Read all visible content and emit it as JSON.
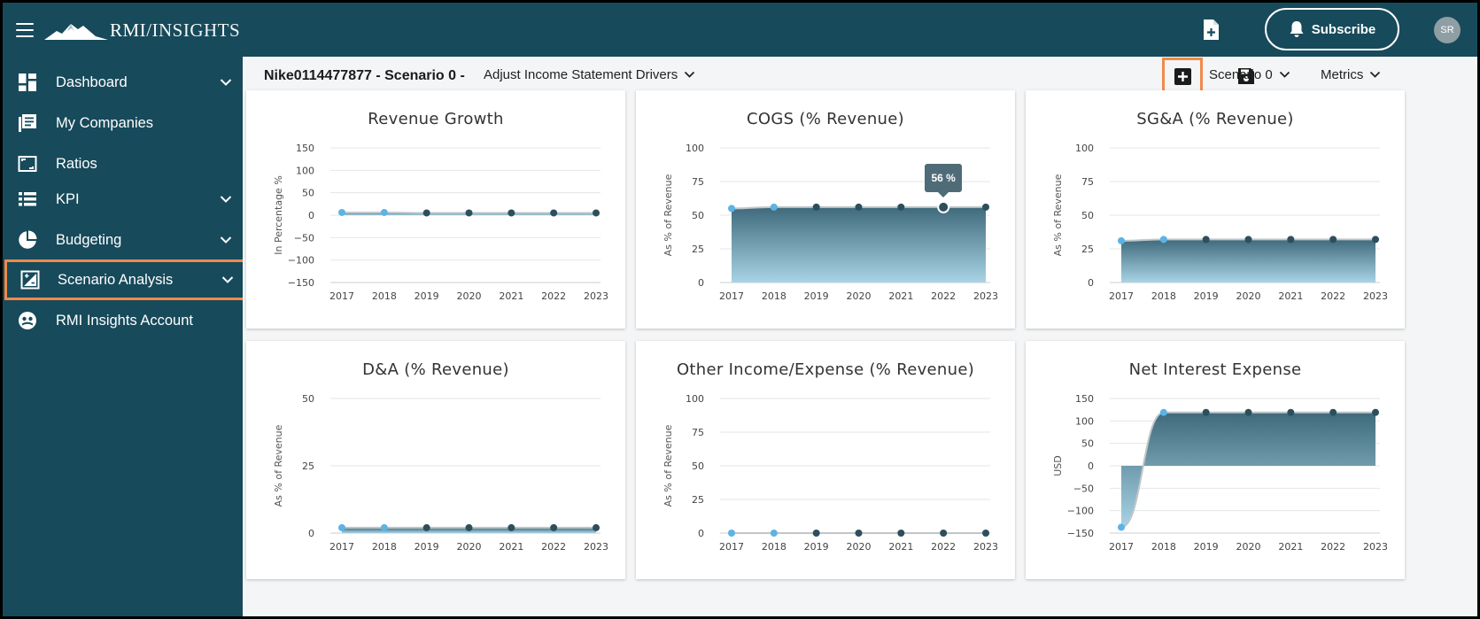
{
  "app": {
    "logo_text_bold": "RMI",
    "logo_text_light": "/INSIGHTS",
    "subscribe_label": "Subscribe",
    "user_initials": "SR"
  },
  "sidebar": {
    "items": [
      {
        "label": "Dashboard",
        "icon": "dashboard-icon",
        "has_chevron": true
      },
      {
        "label": "My Companies",
        "icon": "companies-icon",
        "has_chevron": false
      },
      {
        "label": "Ratios",
        "icon": "ratios-icon",
        "has_chevron": false
      },
      {
        "label": "KPI",
        "icon": "kpi-icon",
        "has_chevron": true
      },
      {
        "label": "Budgeting",
        "icon": "budgeting-icon",
        "has_chevron": true
      },
      {
        "label": "Scenario Analysis",
        "icon": "scenario-icon",
        "has_chevron": true,
        "active": true
      },
      {
        "label": "RMI Insights Account",
        "icon": "account-icon",
        "has_chevron": false
      }
    ]
  },
  "subheader": {
    "title": "Nike0114477877 - Scenario 0 -",
    "driver_select": "Adjust Income Statement Drivers",
    "scenario_select": "Scenario 0",
    "metrics_select": "Metrics"
  },
  "colors": {
    "brand": "#174a5b",
    "highlight": "#f08a4b",
    "historical_point": "#5cb3e4",
    "forecast_point": "#2d4f5c"
  },
  "chart_data": [
    {
      "type": "area",
      "title": "Revenue Growth",
      "ylabel": "In Percentage %",
      "ylim": [
        -150,
        150
      ],
      "yticks": [
        -150,
        -100,
        -50,
        0,
        50,
        100,
        150
      ],
      "x": [
        "2017",
        "2018",
        "2019",
        "2020",
        "2021",
        "2022",
        "2023"
      ],
      "values": [
        6,
        6,
        5,
        5,
        5,
        5,
        5
      ],
      "historical_count": 2
    },
    {
      "type": "area",
      "title": "COGS (% Revenue)",
      "ylabel": "As % of Revenue",
      "ylim": [
        0,
        100
      ],
      "yticks": [
        0,
        25,
        50,
        75,
        100
      ],
      "x": [
        "2017",
        "2018",
        "2019",
        "2020",
        "2021",
        "2022",
        "2023"
      ],
      "values": [
        55,
        56,
        56,
        56,
        56,
        56,
        56
      ],
      "historical_count": 2,
      "tooltip": {
        "index": 5,
        "text": "56 %"
      }
    },
    {
      "type": "area",
      "title": "SG&A (% Revenue)",
      "ylabel": "As % of Revenue",
      "ylim": [
        0,
        100
      ],
      "yticks": [
        0,
        25,
        50,
        75,
        100
      ],
      "x": [
        "2017",
        "2018",
        "2019",
        "2020",
        "2021",
        "2022",
        "2023"
      ],
      "values": [
        31,
        32,
        32,
        32,
        32,
        32,
        32
      ],
      "historical_count": 2
    },
    {
      "type": "area",
      "title": "D&A (% Revenue)",
      "ylabel": "As % of Revenue",
      "ylim": [
        0,
        50
      ],
      "yticks": [
        0,
        25,
        50
      ],
      "x": [
        "2017",
        "2018",
        "2019",
        "2020",
        "2021",
        "2022",
        "2023"
      ],
      "values": [
        2,
        2,
        2,
        2,
        2,
        2,
        2
      ],
      "historical_count": 2
    },
    {
      "type": "area",
      "title": "Other Income/Expense (% Revenue)",
      "ylabel": "As % of Revenue",
      "ylim": [
        0,
        100
      ],
      "yticks": [
        0,
        25,
        50,
        75,
        100
      ],
      "x": [
        "2017",
        "2018",
        "2019",
        "2020",
        "2021",
        "2022",
        "2023"
      ],
      "values": [
        0,
        0,
        0,
        0,
        0,
        0,
        0
      ],
      "historical_count": 2
    },
    {
      "type": "area",
      "title": "Net Interest Expense",
      "ylabel": "USD",
      "ylim": [
        -150,
        150
      ],
      "yticks": [
        -150,
        -100,
        -50,
        0,
        50,
        100,
        150
      ],
      "x": [
        "2017",
        "2018",
        "2019",
        "2020",
        "2021",
        "2022",
        "2023"
      ],
      "values": [
        -137,
        119,
        119,
        119,
        119,
        119,
        119
      ],
      "historical_count": 2
    }
  ]
}
